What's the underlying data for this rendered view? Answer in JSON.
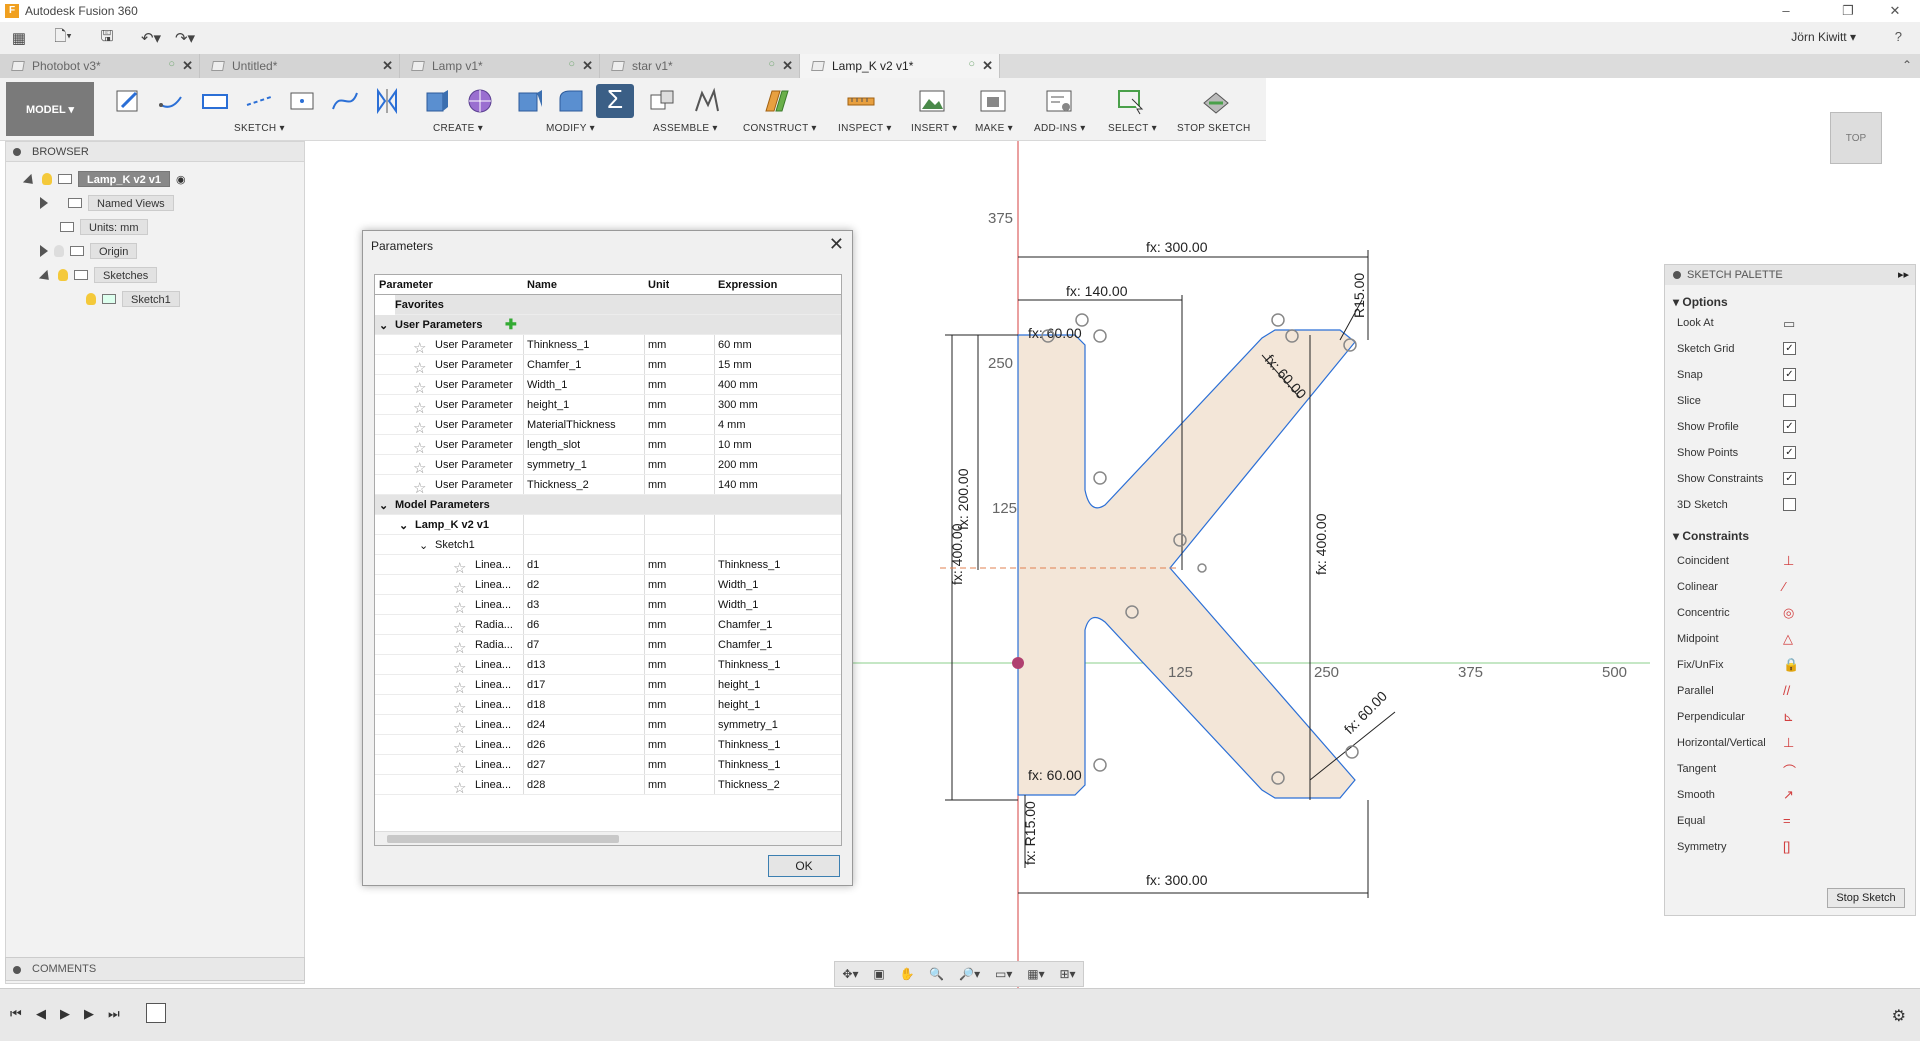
{
  "window": {
    "title": "Autodesk Fusion 360",
    "user": "Jörn Kiwitt",
    "controls": [
      "–",
      "❐",
      "✕"
    ]
  },
  "tabs": [
    {
      "label": "Photobot v3*",
      "active": false
    },
    {
      "label": "Untitled*",
      "active": false
    },
    {
      "label": "Lamp v1*",
      "active": false
    },
    {
      "label": "star v1*",
      "active": false
    },
    {
      "label": "Lamp_K v2 v1*",
      "active": true
    }
  ],
  "toolbar": {
    "workspace": "MODEL ▾",
    "groups": [
      "SKETCH ▾",
      "CREATE ▾",
      "MODIFY ▾",
      "ASSEMBLE ▾",
      "CONSTRUCT ▾",
      "INSPECT ▾",
      "INSERT ▾",
      "MAKE ▾",
      "ADD-INS ▾",
      "SELECT ▾",
      "STOP SKETCH"
    ]
  },
  "browser": {
    "title": "BROWSER",
    "root": "Lamp_K v2 v1",
    "named_views": "Named Views",
    "units": "Units: mm",
    "origin": "Origin",
    "sketches": "Sketches",
    "sketch1": "Sketch1",
    "comments": "COMMENTS"
  },
  "dialog": {
    "title": "Parameters",
    "close": "✕",
    "columns": [
      "Parameter",
      "Name",
      "Unit",
      "Expression"
    ],
    "favorites": "Favorites",
    "user_group": "User Parameters",
    "user_params": [
      {
        "type": "User Parameter",
        "name": "Thinkness_1",
        "unit": "mm",
        "expr": "60 mm"
      },
      {
        "type": "User Parameter",
        "name": "Chamfer_1",
        "unit": "mm",
        "expr": "15 mm"
      },
      {
        "type": "User Parameter",
        "name": "Width_1",
        "unit": "mm",
        "expr": "400 mm"
      },
      {
        "type": "User Parameter",
        "name": "height_1",
        "unit": "mm",
        "expr": "300 mm"
      },
      {
        "type": "User Parameter",
        "name": "MaterialThickness",
        "unit": "mm",
        "expr": "4 mm"
      },
      {
        "type": "User Parameter",
        "name": "length_slot",
        "unit": "mm",
        "expr": "10 mm"
      },
      {
        "type": "User Parameter",
        "name": "symmetry_1",
        "unit": "mm",
        "expr": "200 mm"
      },
      {
        "type": "User Parameter",
        "name": "Thickness_2",
        "unit": "mm",
        "expr": "140 mm"
      }
    ],
    "model_group": "Model Parameters",
    "component": "Lamp_K v2 v1",
    "sketch": "Sketch1",
    "model_params": [
      {
        "type": "Linea...",
        "name": "d1",
        "unit": "mm",
        "expr": "Thinkness_1"
      },
      {
        "type": "Linea...",
        "name": "d2",
        "unit": "mm",
        "expr": "Width_1"
      },
      {
        "type": "Linea...",
        "name": "d3",
        "unit": "mm",
        "expr": "Width_1"
      },
      {
        "type": "Radia...",
        "name": "d6",
        "unit": "mm",
        "expr": "Chamfer_1"
      },
      {
        "type": "Radia...",
        "name": "d7",
        "unit": "mm",
        "expr": "Chamfer_1"
      },
      {
        "type": "Linea...",
        "name": "d13",
        "unit": "mm",
        "expr": "Thinkness_1"
      },
      {
        "type": "Linea...",
        "name": "d17",
        "unit": "mm",
        "expr": "height_1"
      },
      {
        "type": "Linea...",
        "name": "d18",
        "unit": "mm",
        "expr": "height_1"
      },
      {
        "type": "Linea...",
        "name": "d24",
        "unit": "mm",
        "expr": "symmetry_1"
      },
      {
        "type": "Linea...",
        "name": "d26",
        "unit": "mm",
        "expr": "Thinkness_1"
      },
      {
        "type": "Linea...",
        "name": "d27",
        "unit": "mm",
        "expr": "Thinkness_1"
      },
      {
        "type": "Linea...",
        "name": "d28",
        "unit": "mm",
        "expr": "Thickness_2"
      }
    ],
    "ok": "OK"
  },
  "palette": {
    "title": "SKETCH PALETTE",
    "options_title": "Options",
    "options": [
      {
        "label": "Look At",
        "kind": "icon"
      },
      {
        "label": "Sketch Grid",
        "checked": true
      },
      {
        "label": "Snap",
        "checked": true
      },
      {
        "label": "Slice",
        "checked": false
      },
      {
        "label": "Show Profile",
        "checked": true
      },
      {
        "label": "Show Points",
        "checked": true
      },
      {
        "label": "Show Constraints",
        "checked": true
      },
      {
        "label": "3D Sketch",
        "checked": false
      }
    ],
    "constraints_title": "Constraints",
    "constraints": [
      "Coincident",
      "Colinear",
      "Concentric",
      "Midpoint",
      "Fix/UnFix",
      "Parallel",
      "Perpendicular",
      "Horizontal/Vertical",
      "Tangent",
      "Smooth",
      "Equal",
      "Symmetry"
    ],
    "stop": "Stop Sketch"
  },
  "sketch": {
    "dims": {
      "top_width": "fx: 300.00",
      "inner_width": "fx: 140.00",
      "bottom_width": "fx: 300.00",
      "left_h": "fx: 400.00",
      "inner_h": "fx: 200.00",
      "right_h": "fx: 400.00",
      "diag1": "fx: 60.00",
      "diag2": "fx: 60.00",
      "r_top": "R15.00",
      "r_bot": "fx: R15.00",
      "t_top": "fx: 60.00",
      "t_bot": "fx: 60.00"
    },
    "axis_x": [
      "125",
      "250",
      "375",
      "500"
    ],
    "axis_y": [
      "375",
      "250",
      "125"
    ],
    "viewcube": "TOP",
    "colors": {
      "profile": "#f3e6d8",
      "line": "#2b6fd6",
      "axis_green": "#2fa32f",
      "axis_red": "#d54040"
    }
  }
}
